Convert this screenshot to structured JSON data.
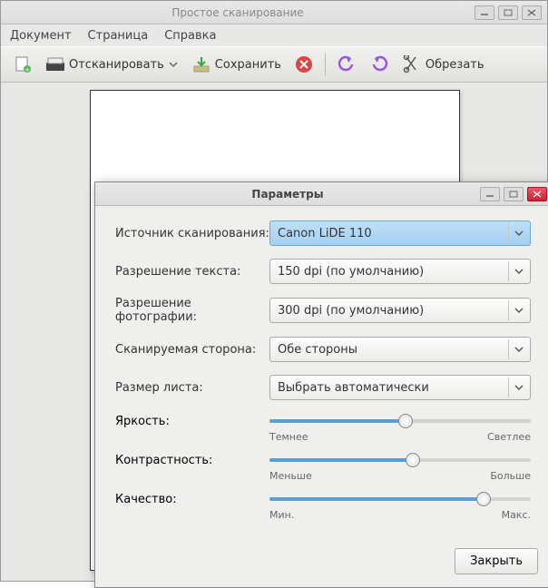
{
  "window": {
    "title": "Простое сканирование"
  },
  "menubar": {
    "document": "Документ",
    "page": "Страница",
    "help": "Справка"
  },
  "toolbar": {
    "scan": "Отсканировать",
    "save": "Сохранить",
    "crop": "Обрезать"
  },
  "dialog": {
    "title": "Параметры",
    "labels": {
      "source": "Источник сканирования:",
      "text_res": "Разрешение текста:",
      "photo_res": "Разрешение фотографии:",
      "side": "Сканируемая сторона:",
      "paper": "Размер листа:",
      "brightness": "Яркость:",
      "contrast": "Контрастность:",
      "quality": "Качество:"
    },
    "values": {
      "source": "Canon LiDE 110",
      "text_res": "150 dpi (по умолчанию)",
      "photo_res": "300 dpi (по умолчанию)",
      "side": "Обе стороны",
      "paper": "Выбрать автоматически"
    },
    "slider_labels": {
      "brightness_min": "Темнее",
      "brightness_max": "Светлее",
      "contrast_min": "Меньше",
      "contrast_max": "Больше",
      "quality_min": "Мин.",
      "quality_max": "Макс."
    },
    "sliders": {
      "brightness_pct": 52,
      "contrast_pct": 55,
      "quality_pct": 82
    },
    "close_btn": "Закрыть"
  }
}
